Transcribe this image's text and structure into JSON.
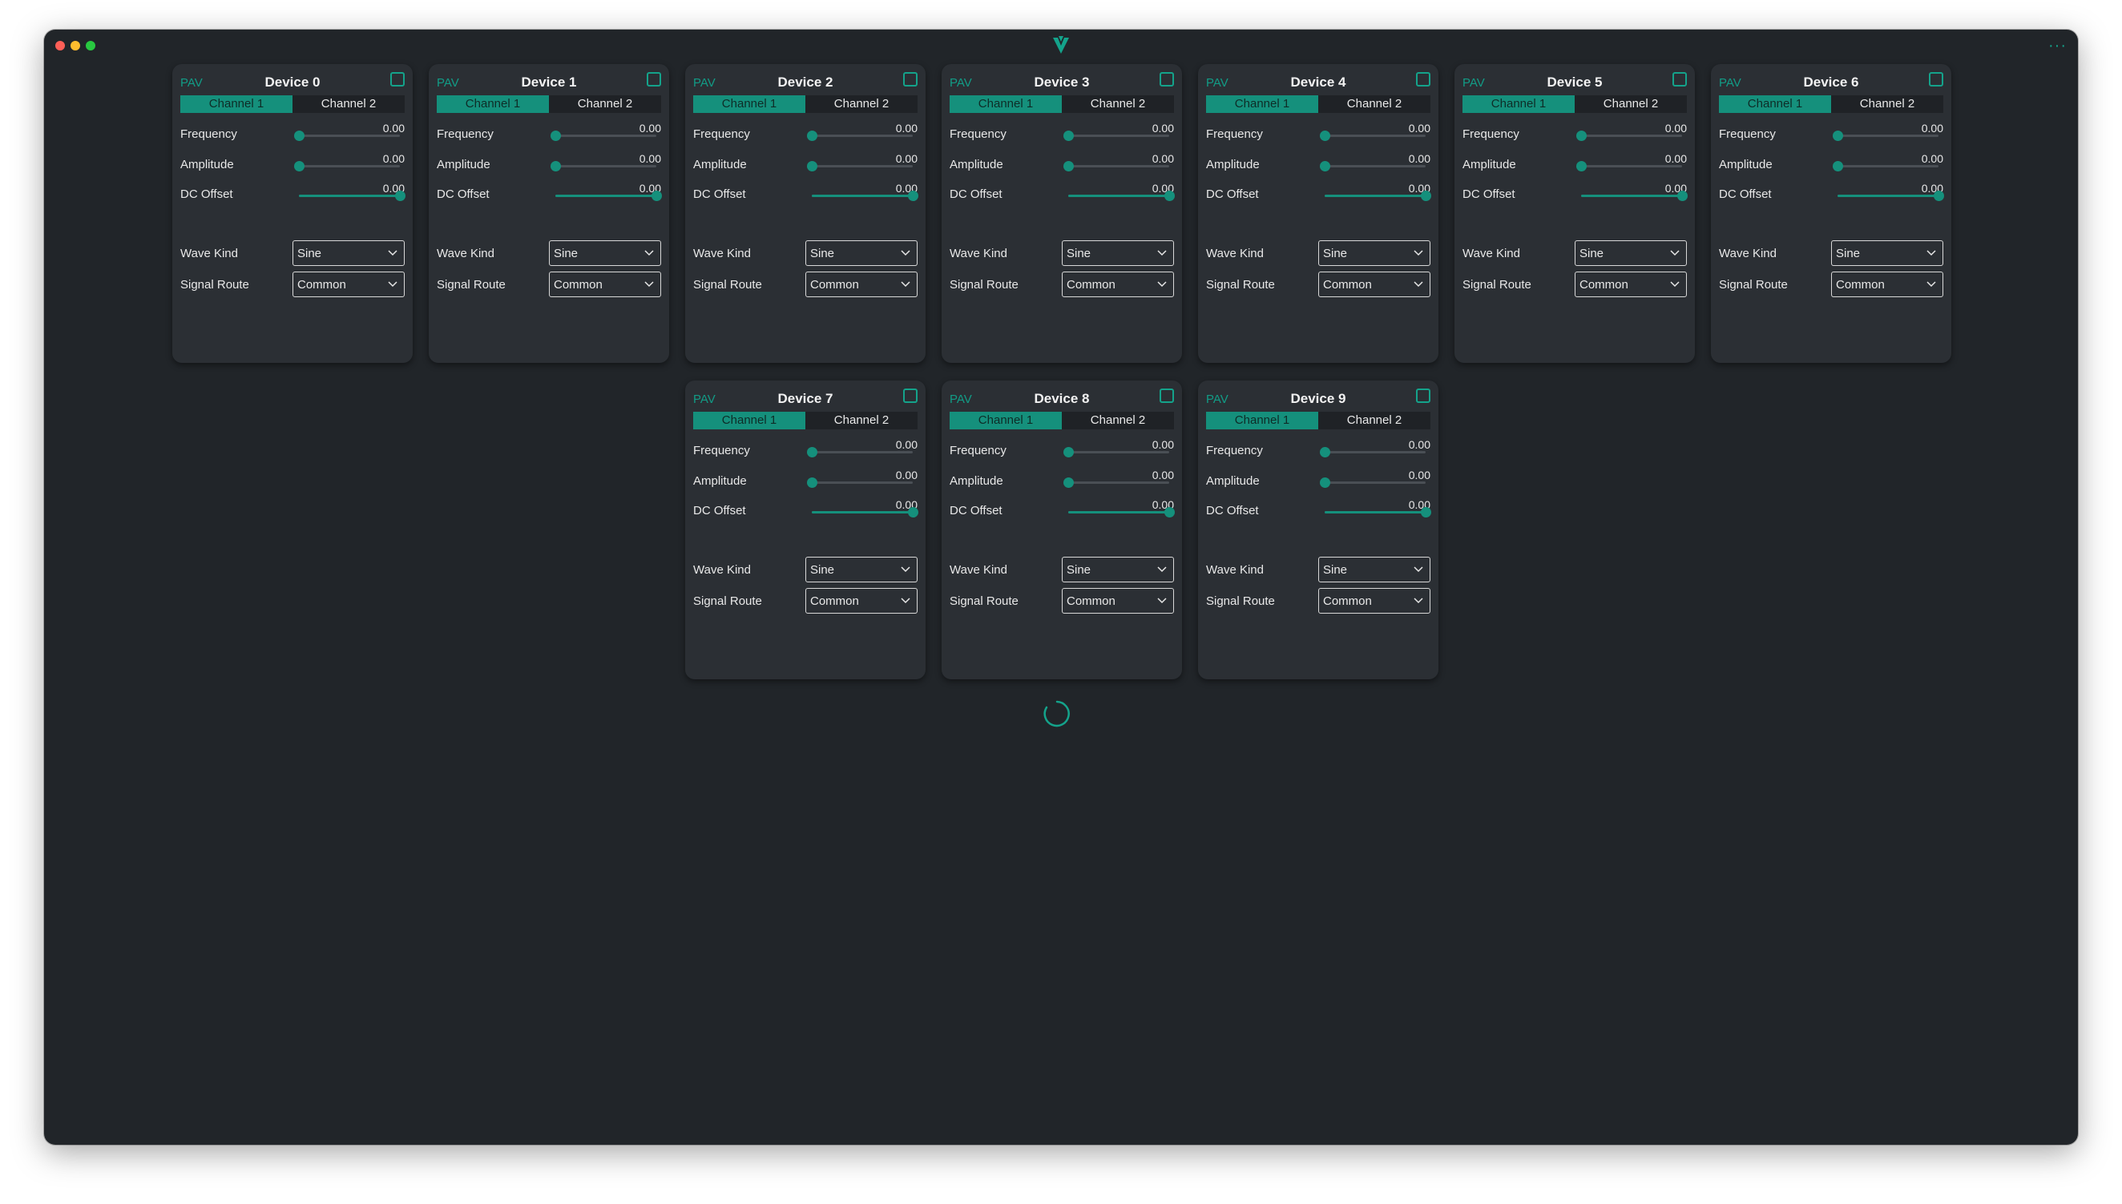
{
  "window": {
    "traffic_lights": [
      "close",
      "minimize",
      "maximize"
    ],
    "logo_icon": "vector-logo-icon",
    "menu_icon": "more-dots-icon",
    "menu_glyph": "···"
  },
  "colors": {
    "accent": "#15907c",
    "window_bg": "#212529",
    "card_bg": "#2b2f34",
    "text": "#e8e8e8"
  },
  "devices": [
    {
      "tag": "PAV",
      "title": "Device 0",
      "tabs": [
        "Channel 1",
        "Channel 2"
      ],
      "active_tab": 0,
      "sliders": [
        {
          "label": "Frequency",
          "value": "0.00",
          "level": 0
        },
        {
          "label": "Amplitude",
          "value": "0.00",
          "level": 0
        },
        {
          "label": "DC Offset",
          "value": "0.00",
          "level": 1
        }
      ],
      "selects": [
        {
          "label": "Wave Kind",
          "value": "Sine"
        },
        {
          "label": "Signal Route",
          "value": "Common"
        }
      ]
    },
    {
      "tag": "PAV",
      "title": "Device 1",
      "tabs": [
        "Channel 1",
        "Channel 2"
      ],
      "active_tab": 0,
      "sliders": [
        {
          "label": "Frequency",
          "value": "0.00",
          "level": 0
        },
        {
          "label": "Amplitude",
          "value": "0.00",
          "level": 0
        },
        {
          "label": "DC Offset",
          "value": "0.00",
          "level": 1
        }
      ],
      "selects": [
        {
          "label": "Wave Kind",
          "value": "Sine"
        },
        {
          "label": "Signal Route",
          "value": "Common"
        }
      ]
    },
    {
      "tag": "PAV",
      "title": "Device 2",
      "tabs": [
        "Channel 1",
        "Channel 2"
      ],
      "active_tab": 0,
      "sliders": [
        {
          "label": "Frequency",
          "value": "0.00",
          "level": 0
        },
        {
          "label": "Amplitude",
          "value": "0.00",
          "level": 0
        },
        {
          "label": "DC Offset",
          "value": "0.00",
          "level": 1
        }
      ],
      "selects": [
        {
          "label": "Wave Kind",
          "value": "Sine"
        },
        {
          "label": "Signal Route",
          "value": "Common"
        }
      ]
    },
    {
      "tag": "PAV",
      "title": "Device 3",
      "tabs": [
        "Channel 1",
        "Channel 2"
      ],
      "active_tab": 0,
      "sliders": [
        {
          "label": "Frequency",
          "value": "0.00",
          "level": 0
        },
        {
          "label": "Amplitude",
          "value": "0.00",
          "level": 0
        },
        {
          "label": "DC Offset",
          "value": "0.00",
          "level": 1
        }
      ],
      "selects": [
        {
          "label": "Wave Kind",
          "value": "Sine"
        },
        {
          "label": "Signal Route",
          "value": "Common"
        }
      ]
    },
    {
      "tag": "PAV",
      "title": "Device 4",
      "tabs": [
        "Channel 1",
        "Channel 2"
      ],
      "active_tab": 0,
      "sliders": [
        {
          "label": "Frequency",
          "value": "0.00",
          "level": 0
        },
        {
          "label": "Amplitude",
          "value": "0.00",
          "level": 0
        },
        {
          "label": "DC Offset",
          "value": "0.00",
          "level": 1
        }
      ],
      "selects": [
        {
          "label": "Wave Kind",
          "value": "Sine"
        },
        {
          "label": "Signal Route",
          "value": "Common"
        }
      ]
    },
    {
      "tag": "PAV",
      "title": "Device 5",
      "tabs": [
        "Channel 1",
        "Channel 2"
      ],
      "active_tab": 0,
      "sliders": [
        {
          "label": "Frequency",
          "value": "0.00",
          "level": 0
        },
        {
          "label": "Amplitude",
          "value": "0.00",
          "level": 0
        },
        {
          "label": "DC Offset",
          "value": "0.00",
          "level": 1
        }
      ],
      "selects": [
        {
          "label": "Wave Kind",
          "value": "Sine"
        },
        {
          "label": "Signal Route",
          "value": "Common"
        }
      ]
    },
    {
      "tag": "PAV",
      "title": "Device 6",
      "tabs": [
        "Channel 1",
        "Channel 2"
      ],
      "active_tab": 0,
      "sliders": [
        {
          "label": "Frequency",
          "value": "0.00",
          "level": 0
        },
        {
          "label": "Amplitude",
          "value": "0.00",
          "level": 0
        },
        {
          "label": "DC Offset",
          "value": "0.00",
          "level": 1
        }
      ],
      "selects": [
        {
          "label": "Wave Kind",
          "value": "Sine"
        },
        {
          "label": "Signal Route",
          "value": "Common"
        }
      ]
    },
    {
      "tag": "PAV",
      "title": "Device 7",
      "tabs": [
        "Channel 1",
        "Channel 2"
      ],
      "active_tab": 0,
      "sliders": [
        {
          "label": "Frequency",
          "value": "0.00",
          "level": 0
        },
        {
          "label": "Amplitude",
          "value": "0.00",
          "level": 0
        },
        {
          "label": "DC Offset",
          "value": "0.00",
          "level": 1
        }
      ],
      "selects": [
        {
          "label": "Wave Kind",
          "value": "Sine"
        },
        {
          "label": "Signal Route",
          "value": "Common"
        }
      ]
    },
    {
      "tag": "PAV",
      "title": "Device 8",
      "tabs": [
        "Channel 1",
        "Channel 2"
      ],
      "active_tab": 0,
      "sliders": [
        {
          "label": "Frequency",
          "value": "0.00",
          "level": 0
        },
        {
          "label": "Amplitude",
          "value": "0.00",
          "level": 0
        },
        {
          "label": "DC Offset",
          "value": "0.00",
          "level": 1
        }
      ],
      "selects": [
        {
          "label": "Wave Kind",
          "value": "Sine"
        },
        {
          "label": "Signal Route",
          "value": "Common"
        }
      ]
    },
    {
      "tag": "PAV",
      "title": "Device 9",
      "tabs": [
        "Channel 1",
        "Channel 2"
      ],
      "active_tab": 0,
      "sliders": [
        {
          "label": "Frequency",
          "value": "0.00",
          "level": 0
        },
        {
          "label": "Amplitude",
          "value": "0.00",
          "level": 0
        },
        {
          "label": "DC Offset",
          "value": "0.00",
          "level": 1
        }
      ],
      "selects": [
        {
          "label": "Wave Kind",
          "value": "Sine"
        },
        {
          "label": "Signal Route",
          "value": "Common"
        }
      ]
    }
  ],
  "loading": {
    "icon": "loading-spinner-icon"
  }
}
